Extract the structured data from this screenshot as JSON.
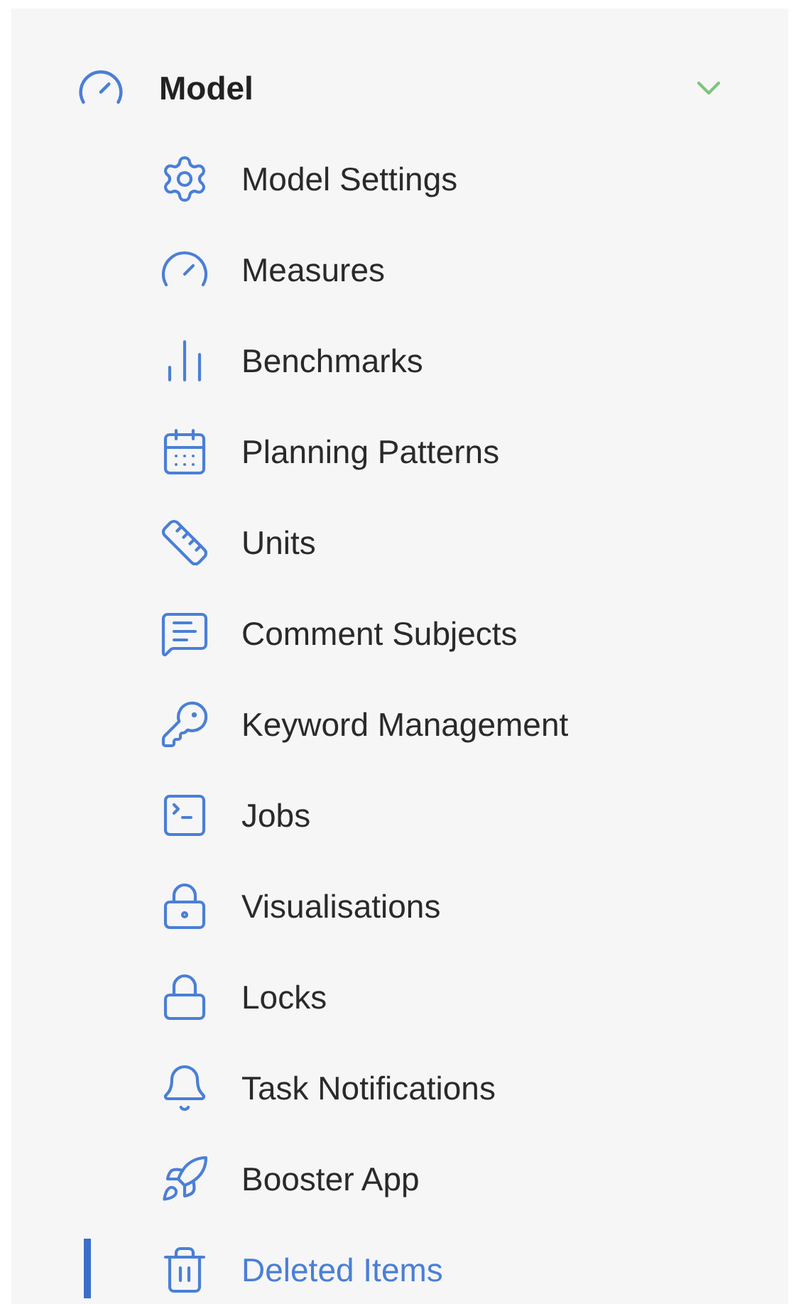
{
  "section": {
    "label": "Model",
    "expanded": true,
    "items": [
      {
        "kind": "settings",
        "label": "Model Settings",
        "selected": false
      },
      {
        "kind": "gauge",
        "label": "Measures",
        "selected": false
      },
      {
        "kind": "bars",
        "label": "Benchmarks",
        "selected": false
      },
      {
        "kind": "calendar",
        "label": "Planning Patterns",
        "selected": false
      },
      {
        "kind": "ruler",
        "label": "Units",
        "selected": false
      },
      {
        "kind": "comment",
        "label": "Comment Subjects",
        "selected": false
      },
      {
        "kind": "key",
        "label": "Keyword Management",
        "selected": false
      },
      {
        "kind": "terminal",
        "label": "Jobs",
        "selected": false
      },
      {
        "kind": "padlock-list",
        "label": "Visualisations",
        "selected": false
      },
      {
        "kind": "lock",
        "label": "Locks",
        "selected": false
      },
      {
        "kind": "bell",
        "label": "Task Notifications",
        "selected": false
      },
      {
        "kind": "rocket",
        "label": "Booster App",
        "selected": false
      },
      {
        "kind": "trash",
        "label": "Deleted Items",
        "selected": true
      }
    ]
  }
}
